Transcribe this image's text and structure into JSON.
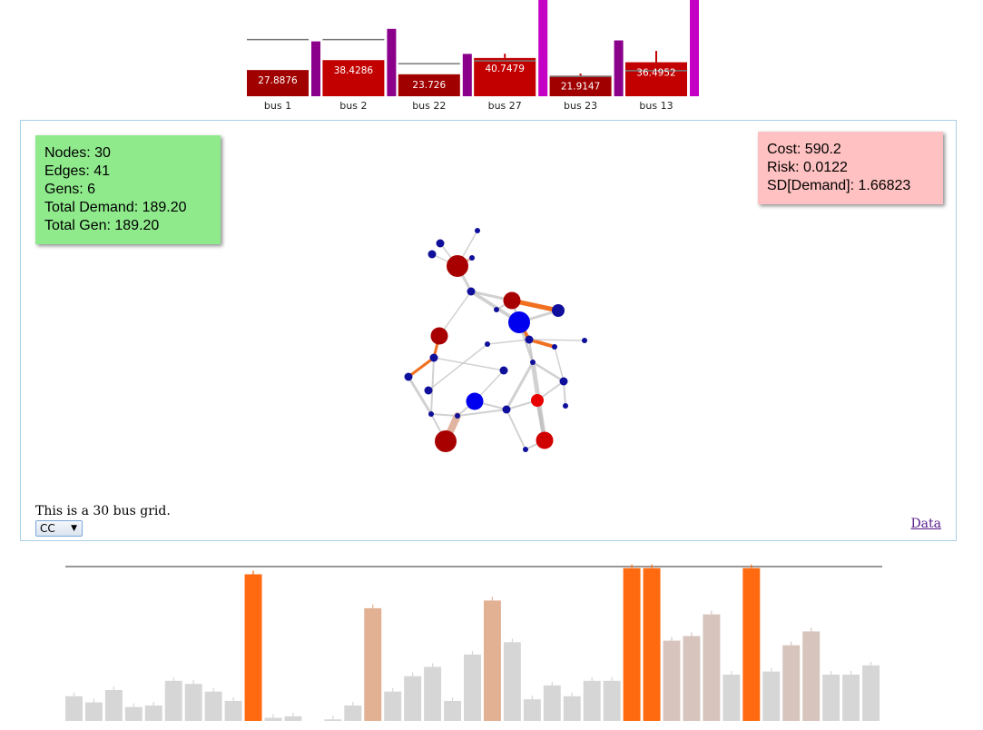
{
  "generators": {
    "buses": [
      {
        "label": "bus 1",
        "value": "27.8876",
        "bar_frac": 0.37,
        "limit_frac": 0.8,
        "purple_frac": 0.57,
        "err": 0
      },
      {
        "label": "bus 2",
        "value": "38.4286",
        "bar_frac": 0.51,
        "limit_frac": 0.8,
        "purple_frac": 0.7,
        "err": 0
      },
      {
        "label": "bus 22",
        "value": "23.726",
        "bar_frac": 0.31,
        "limit_frac": 0.46,
        "purple_frac": 0.44,
        "err": 0
      },
      {
        "label": "bus 27",
        "value": "40.7479",
        "bar_frac": 0.54,
        "limit_frac": 0.5,
        "purple_frac": 1.0,
        "err": 0.06
      },
      {
        "label": "bus 23",
        "value": "21.9147",
        "bar_frac": 0.29,
        "limit_frac": 0.28,
        "purple_frac": 0.58,
        "err": 0.03
      },
      {
        "label": "bus 13",
        "value": "36.4952",
        "bar_frac": 0.48,
        "limit_frac": 0.36,
        "purple_frac": 1.0,
        "err": 0.16
      }
    ],
    "colors": {
      "bar": "#c20000",
      "bar_dark": "#a00000",
      "purple": "#8b008b",
      "magenta": "#c400c4",
      "limit": "#777777"
    }
  },
  "stats": {
    "nodes": "Nodes: 30",
    "edges": "Edges: 41",
    "gens": "Gens: 6",
    "total_demand": "Total Demand: 189.20",
    "total_gen": "Total Gen: 189.20"
  },
  "cost": {
    "cost": "Cost: 590.2",
    "risk": "Risk: 0.0122",
    "sd_demand": "SD[Demand]: 1.66823"
  },
  "description": "This is a 30 bus grid.",
  "select_value": "CC",
  "data_link": "Data",
  "line_flows": {
    "limit_frac": 1.0,
    "colors": {
      "high": "#ff6a10",
      "mid": "#e2b092",
      "low": "#d7c4bd",
      "base": "#d6d6d6"
    },
    "values": [
      0.16,
      0.12,
      0.2,
      0.09,
      0.1,
      0.26,
      0.24,
      0.19,
      0.13,
      0.95,
      0.02,
      0.03,
      0.0,
      0.01,
      0.1,
      0.73,
      0.19,
      0.29,
      0.35,
      0.13,
      0.43,
      0.78,
      0.51,
      0.14,
      0.23,
      0.16,
      0.26,
      0.26,
      0.99,
      0.99,
      0.52,
      0.55,
      0.69,
      0.3,
      0.99,
      0.32,
      0.49,
      0.58,
      0.3,
      0.3,
      0.36
    ],
    "levels": [
      "base",
      "base",
      "base",
      "base",
      "base",
      "base",
      "base",
      "base",
      "base",
      "high",
      "base",
      "base",
      "base",
      "base",
      "base",
      "mid",
      "base",
      "base",
      "base",
      "base",
      "base",
      "mid",
      "base",
      "base",
      "base",
      "base",
      "base",
      "base",
      "high",
      "high",
      "low",
      "low",
      "low",
      "base",
      "high",
      "base",
      "low",
      "low",
      "base",
      "base",
      "base"
    ]
  },
  "graph": {
    "nodes": [
      {
        "id": "n1",
        "size": "xl",
        "color": "#a80000"
      },
      {
        "id": "n2",
        "size": "sm",
        "color": "#0f0f9b"
      },
      {
        "id": "n3",
        "size": "sm",
        "color": "#0f0f9b"
      },
      {
        "id": "n4",
        "size": "xs",
        "color": "#0f0f9b"
      },
      {
        "id": "n5",
        "size": "xs",
        "color": "#0f0f9b"
      },
      {
        "id": "n6",
        "size": "sm",
        "color": "#0f0f9b"
      },
      {
        "id": "n7",
        "size": "lg",
        "color": "#a80000"
      },
      {
        "id": "n8",
        "size": "xs",
        "color": "#0f0f9b"
      },
      {
        "id": "n9",
        "size": "md",
        "color": "#0f0f9b"
      },
      {
        "id": "n10",
        "size": "xl",
        "color": "#0000ee"
      },
      {
        "id": "n11",
        "size": "lg",
        "color": "#a80000"
      },
      {
        "id": "n12",
        "size": "xs",
        "color": "#0f0f9b"
      },
      {
        "id": "n13",
        "size": "sm",
        "color": "#0f0f9b"
      },
      {
        "id": "n14",
        "size": "xs",
        "color": "#0f0f9b"
      },
      {
        "id": "n15",
        "size": "xs",
        "color": "#0f0f9b"
      },
      {
        "id": "n16",
        "size": "sm",
        "color": "#0f0f9b"
      },
      {
        "id": "n17",
        "size": "sm",
        "color": "#0f0f9b"
      },
      {
        "id": "n18",
        "size": "sm",
        "color": "#0f0f9b"
      },
      {
        "id": "n19",
        "size": "xs",
        "color": "#0f0f9b"
      },
      {
        "id": "n20",
        "size": "sm",
        "color": "#0f0f9b"
      },
      {
        "id": "n21",
        "size": "sm",
        "color": "#0f0f9b"
      },
      {
        "id": "n22",
        "size": "md",
        "color": "#e80000"
      },
      {
        "id": "n23",
        "size": "lg",
        "color": "#0000ee"
      },
      {
        "id": "n24",
        "size": "xs",
        "color": "#0f0f9b"
      },
      {
        "id": "n25",
        "size": "xs",
        "color": "#0f0f9b"
      },
      {
        "id": "n26",
        "size": "sm",
        "color": "#0f0f9b"
      },
      {
        "id": "n27",
        "size": "xl",
        "color": "#a80000"
      },
      {
        "id": "n28",
        "size": "lg",
        "color": "#d10000"
      },
      {
        "id": "n29",
        "size": "xs",
        "color": "#0f0f9b"
      },
      {
        "id": "n30",
        "size": "xs",
        "color": "#0f0f9b"
      }
    ]
  }
}
